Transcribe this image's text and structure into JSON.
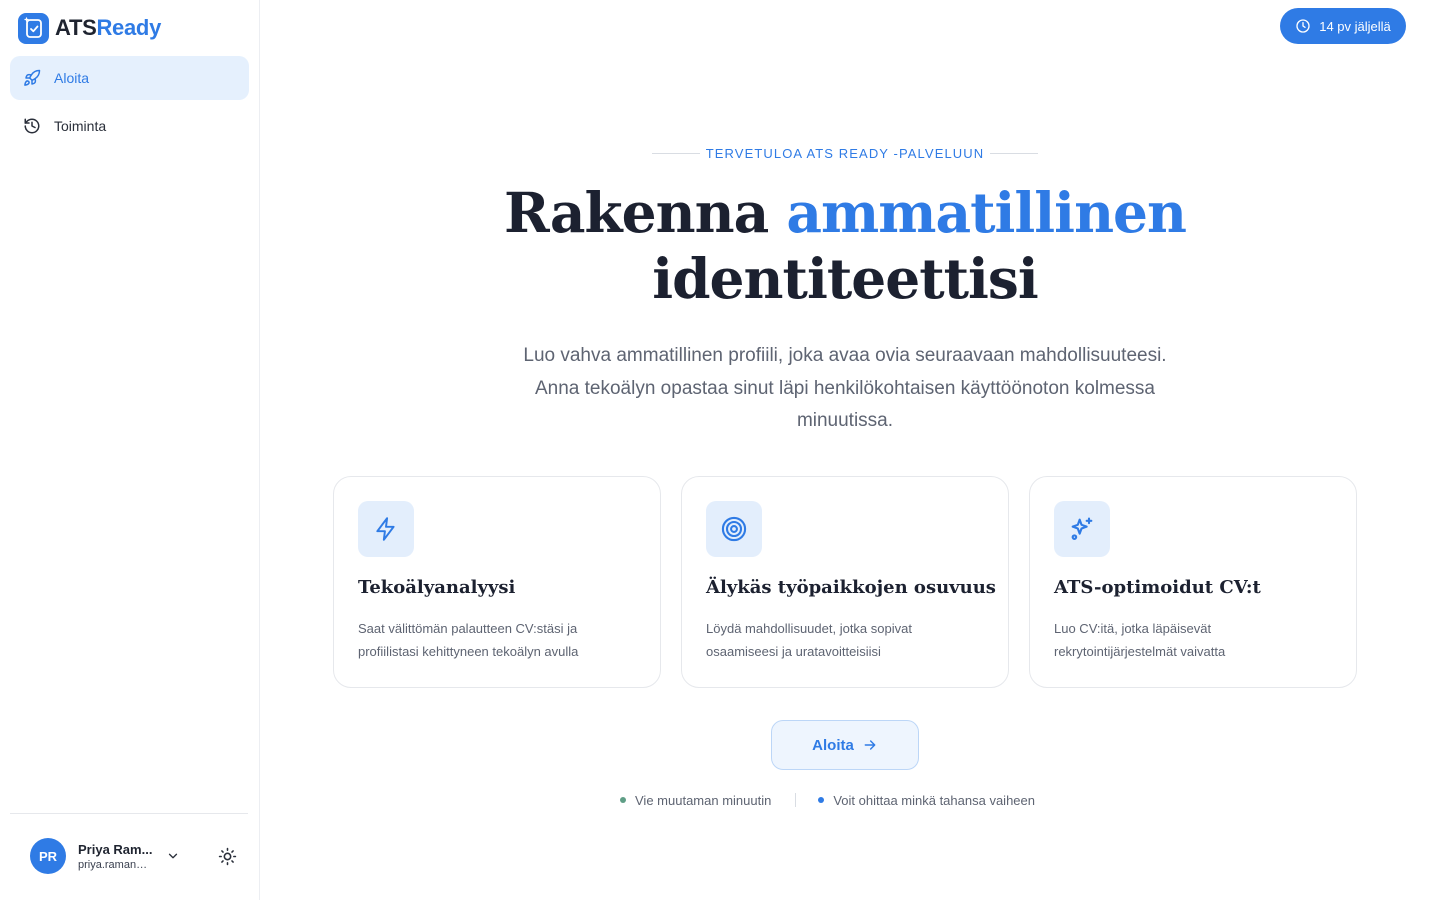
{
  "brand": {
    "name_part1": "ATS",
    "name_part2": "Ready",
    "accent": "#2f7be5"
  },
  "sidebar": {
    "items": [
      {
        "label": "Aloita",
        "icon": "rocket-icon",
        "active": true
      },
      {
        "label": "Toiminta",
        "icon": "history-icon",
        "active": false
      }
    ]
  },
  "user": {
    "initials": "PR",
    "name": "Priya Ram...",
    "email": "priya.raman@..."
  },
  "trial_badge": {
    "label": "14 pv jäljellä",
    "icon": "clock-icon"
  },
  "hero": {
    "eyebrow": "TERVETULOA ATS READY -PALVELUUN",
    "title_part1": "Rakenna",
    "title_highlight": "ammatillinen",
    "title_part2": "identiteettisi",
    "subtitle": "Luo vahva ammatillinen profiili, joka avaa ovia seuraavaan mahdollisuuteesi. Anna tekoälyn opastaa sinut läpi henkilökohtaisen käyttöönoton kolmessa minuutissa."
  },
  "features": [
    {
      "icon": "lightning-icon",
      "title": "Tekoälyanalyysi",
      "description": "Saat välittömän palautteen CV:stäsi ja profiilistasi kehittyneen tekoälyn avulla"
    },
    {
      "icon": "target-icon",
      "title": "Älykäs työpaikkojen osuvuus",
      "description": "Löydä mahdollisuudet, jotka sopivat osaamiseesi ja uratavoitteisiisi"
    },
    {
      "icon": "sparkles-icon",
      "title": "ATS-optimoidut CV:t",
      "description": "Luo CV:itä, jotka läpäisevät rekrytointijärjestelmät vaivatta"
    }
  ],
  "cta": {
    "label": "Aloita",
    "icon": "arrow-right-icon"
  },
  "notes": [
    {
      "text": "Vie muutaman minuutin",
      "color": "#5f9e86"
    },
    {
      "text": "Voit ohittaa minkä tahansa vaiheen",
      "color": "#2f7be5"
    }
  ]
}
